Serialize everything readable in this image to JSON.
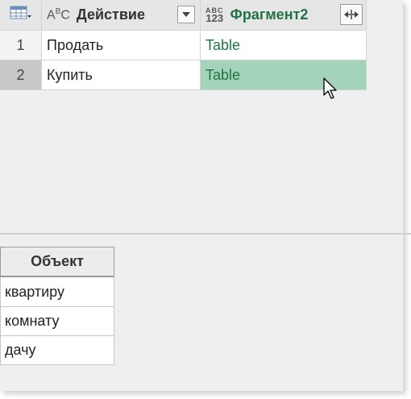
{
  "columns": [
    {
      "type_icon": "ABC",
      "label": "Действие"
    },
    {
      "type_icon_top": "ABC",
      "type_icon_bottom": "123",
      "label": "Фрагмент2"
    }
  ],
  "rows": [
    {
      "num": "1",
      "action": "Продать",
      "fragment": "Table"
    },
    {
      "num": "2",
      "action": "Купить",
      "fragment": "Table"
    }
  ],
  "preview": {
    "header": "Объект",
    "items": [
      "квартиру",
      "комнату",
      "дачу"
    ]
  },
  "colors": {
    "selected_cell": "#a3d3b9",
    "fragment_text": "#217346",
    "selected_row_number": "#c8c8c8"
  }
}
